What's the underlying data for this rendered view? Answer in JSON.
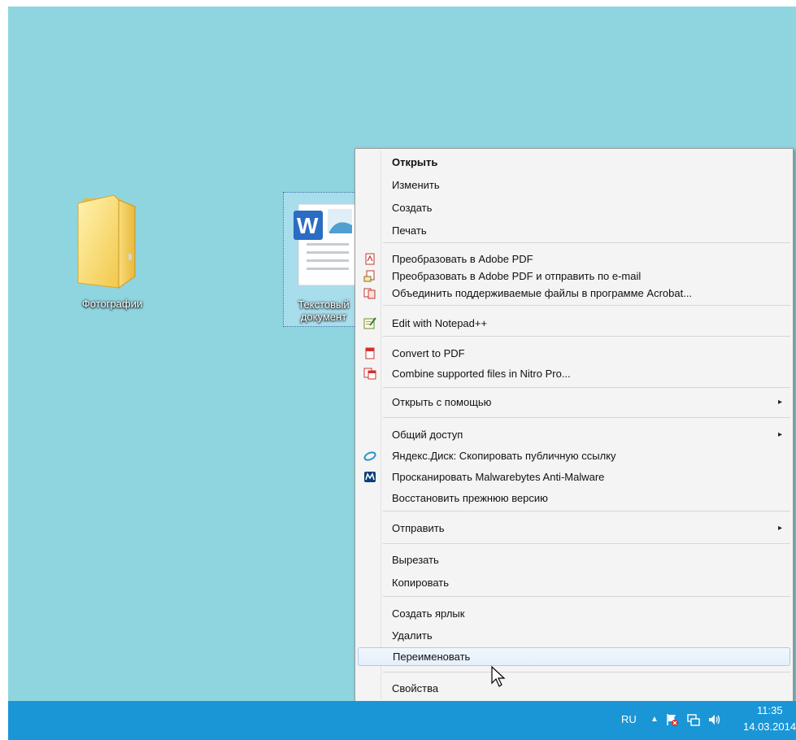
{
  "desktop": {
    "background": "#8fd5e0",
    "icons": [
      {
        "label": "Фотографии",
        "icon": "folder-icon"
      },
      {
        "label_line1": "Текстовый",
        "label_line2": "документ",
        "icon": "word-document-icon"
      }
    ]
  },
  "context_menu": {
    "items": [
      {
        "label": "Открыть",
        "bold": true
      },
      {
        "label": "Изменить"
      },
      {
        "label": "Создать"
      },
      {
        "label": "Печать"
      },
      {
        "label": "Преобразовать в Adobe PDF",
        "icon": "adobe-pdf-icon"
      },
      {
        "label": "Преобразовать в Adobe PDF и отправить по e-mail",
        "icon": "adobe-pdf-email-icon"
      },
      {
        "label": "Объединить поддерживаемые файлы в программе Acrobat...",
        "icon": "acrobat-combine-icon"
      },
      {
        "label": "Edit with Notepad++",
        "icon": "notepad-plus-plus-icon"
      },
      {
        "label": "Convert to PDF",
        "icon": "nitro-pdf-icon"
      },
      {
        "label": "Combine supported files in Nitro Pro...",
        "icon": "nitro-combine-icon"
      },
      {
        "label": "Открыть с помощью",
        "submenu": true
      },
      {
        "label": "Общий доступ",
        "submenu": true
      },
      {
        "label": "Яндекс.Диск: Скопировать публичную ссылку",
        "icon": "yandex-disk-icon"
      },
      {
        "label": "Просканировать Malwarebytes Anti-Malware",
        "icon": "malwarebytes-icon"
      },
      {
        "label": "Восстановить прежнюю версию"
      },
      {
        "label": "Отправить",
        "submenu": true
      },
      {
        "label": "Вырезать"
      },
      {
        "label": "Копировать"
      },
      {
        "label": "Создать ярлык"
      },
      {
        "label": "Удалить"
      },
      {
        "label": "Переименовать",
        "highlighted": true
      },
      {
        "label": "Свойства"
      }
    ],
    "submenu_arrow": "▸"
  },
  "taskbar": {
    "color": "#1a96d6",
    "language": "RU",
    "tray_expand": "▲",
    "time": "11:35",
    "date": "14.03.2014"
  }
}
